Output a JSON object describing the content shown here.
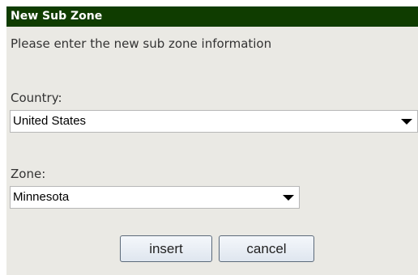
{
  "form": {
    "title": "New Sub Zone",
    "instructions": "Please enter the new sub zone information",
    "country": {
      "label": "Country:",
      "value": "United States"
    },
    "zone": {
      "label": "Zone:",
      "value": "Minnesota"
    },
    "buttons": {
      "insert_label": "insert",
      "cancel_label": "cancel"
    }
  },
  "colors": {
    "header_bg": "#0f3c00",
    "panel_bg": "#eae9e4"
  }
}
